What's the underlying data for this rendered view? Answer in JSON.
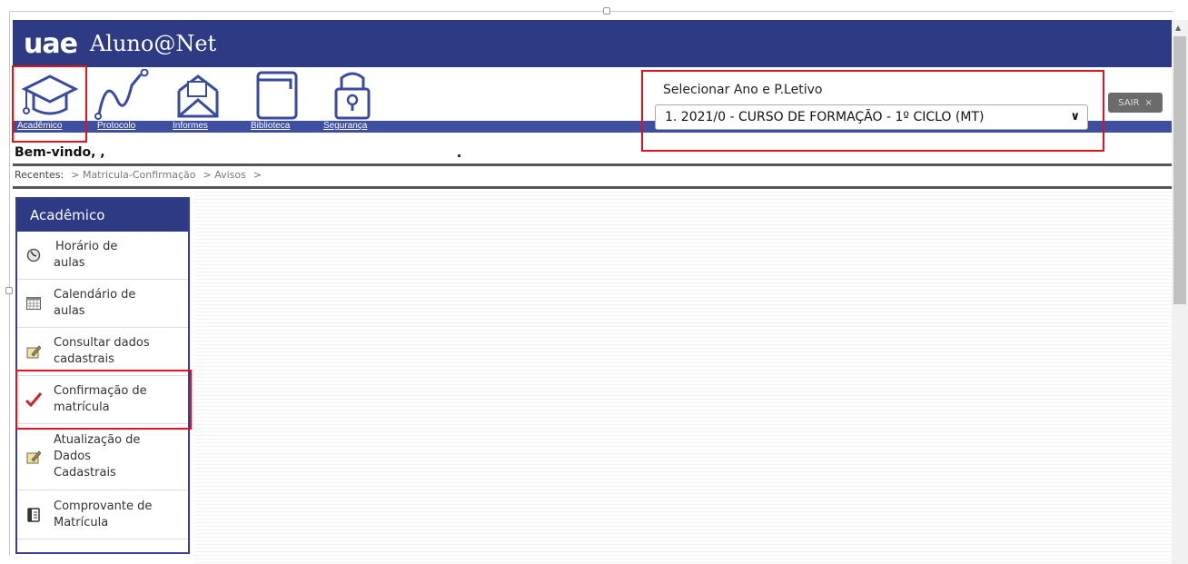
{
  "app": {
    "logo_mark": "uae",
    "title": "Aluno@Net",
    "brand_color": "#2e3a84",
    "highlight_color": "#e1121c"
  },
  "toolbar": {
    "items": [
      {
        "label": "Acadêmico",
        "icon": "graduation-cap-icon"
      },
      {
        "label": "Protocolo",
        "icon": "line-graph-icon"
      },
      {
        "label": "Informes",
        "icon": "envelope-icon"
      },
      {
        "label": "Biblioteca",
        "icon": "book-icon"
      },
      {
        "label": "Segurança",
        "icon": "padlock-icon"
      }
    ]
  },
  "period_selector": {
    "label": "Selecionar Ano e P.Letivo",
    "selected": "1. 2021/0 - CURSO DE FORMAÇÃO - 1º CICLO (MT)"
  },
  "logout": {
    "label": "SAIR",
    "close": "×"
  },
  "welcome": {
    "text": "Bem-vindo, ,"
  },
  "recent": {
    "label": "Recentes:",
    "items": [
      "> Matricula-Confirmação",
      "> Avisos",
      ">"
    ]
  },
  "sidebar": {
    "title": "Acadêmico",
    "items": [
      {
        "line1": "Horário de",
        "line2": "aulas",
        "icon": "clock-icon"
      },
      {
        "line1": "Calendário de",
        "line2": "aulas",
        "icon": "calendar-icon"
      },
      {
        "line1": "Consultar dados",
        "line2": "cadastrais",
        "icon": "edit-note-icon"
      },
      {
        "line1": "Confirmação de",
        "line2": "matrícula",
        "icon": "checkmark-icon"
      },
      {
        "line1": "Atualização de",
        "line2": "Dados",
        "line3": "Cadastrais",
        "icon": "edit-note-icon"
      },
      {
        "line1": "Comprovante de",
        "line2": "Matrícula",
        "icon": "document-icon"
      }
    ]
  }
}
